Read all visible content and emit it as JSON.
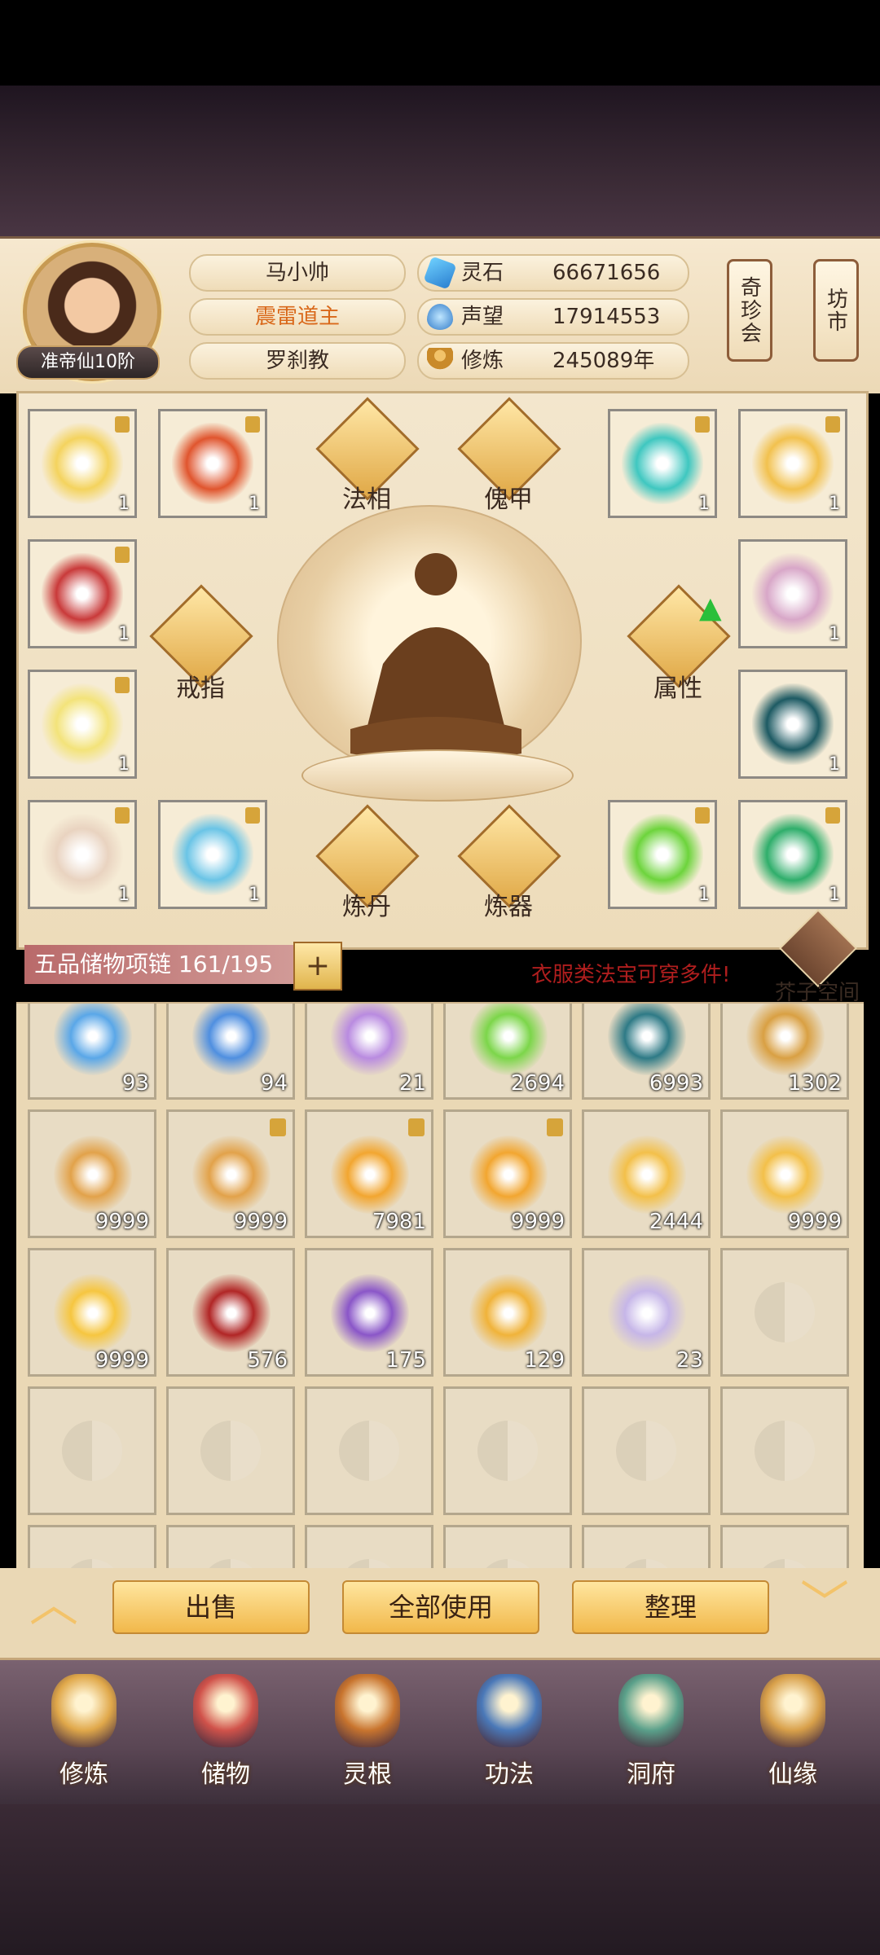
{
  "player": {
    "name": "马小帅",
    "title": "震雷道主",
    "sect": "罗刹教",
    "realm": "准帝仙10阶"
  },
  "resources": [
    {
      "label": "灵石",
      "value": "66671656",
      "icon": "spirit-stone-icon"
    },
    {
      "label": "声望",
      "value": "17914553",
      "icon": "prestige-icon"
    },
    {
      "label": "修炼",
      "value": "245089年",
      "icon": "cultivation-icon"
    }
  ],
  "side_buttons": {
    "treasure_shop": "奇珍会",
    "market": "坊市"
  },
  "equip_actions": {
    "faxiang": "法相",
    "kuijia": "傀甲",
    "ring": "戒指",
    "attributes": "属性",
    "alchemy": "炼丹",
    "forge": "炼器"
  },
  "equipment": [
    {
      "count": "1",
      "locked": true,
      "color": "#f4d35e"
    },
    {
      "count": "1",
      "locked": true,
      "color": "#e0552e"
    },
    {
      "count": "1",
      "locked": true,
      "color": "#3fc7c0"
    },
    {
      "count": "1",
      "locked": true,
      "color": "#f2c14e"
    },
    {
      "count": "1",
      "locked": true,
      "color": "#c93a3a"
    },
    {
      "count": "1",
      "locked": false,
      "color": "#d8a7c8"
    },
    {
      "count": "1",
      "locked": true,
      "color": "#f3e37a"
    },
    {
      "count": "1",
      "locked": false,
      "color": "#1d5a63"
    },
    {
      "count": "1",
      "locked": true,
      "color": "#e9d3c0"
    },
    {
      "count": "1",
      "locked": true,
      "color": "#6ac4e6"
    },
    {
      "count": "1",
      "locked": true,
      "color": "#6dd43c"
    },
    {
      "count": "1",
      "locked": true,
      "color": "#2fae6b"
    }
  ],
  "storage": {
    "title": "五品储物项链 161/195",
    "plus": "+",
    "hint": "衣服类法宝可穿多件!",
    "jiezi": "芥子空间"
  },
  "items": [
    {
      "count": "93",
      "locked": false,
      "color": "#5aa7e8"
    },
    {
      "count": "94",
      "locked": false,
      "color": "#4f8fe0"
    },
    {
      "count": "21",
      "locked": false,
      "color": "#b98be0"
    },
    {
      "count": "2694",
      "locked": false,
      "color": "#7cd64a"
    },
    {
      "count": "6993",
      "locked": false,
      "color": "#2e7a86"
    },
    {
      "count": "1302",
      "locked": false,
      "color": "#d9a043"
    },
    {
      "count": "9999",
      "locked": false,
      "color": "#e2a24a"
    },
    {
      "count": "9999",
      "locked": true,
      "color": "#e2a24a"
    },
    {
      "count": "7981",
      "locked": true,
      "color": "#f2a630"
    },
    {
      "count": "9999",
      "locked": true,
      "color": "#f2a630"
    },
    {
      "count": "2444",
      "locked": false,
      "color": "#f3c04a"
    },
    {
      "count": "9999",
      "locked": false,
      "color": "#f3c04a"
    },
    {
      "count": "9999",
      "locked": false,
      "color": "#f6c640"
    },
    {
      "count": "576",
      "locked": false,
      "color": "#b12626"
    },
    {
      "count": "175",
      "locked": false,
      "color": "#8a56c8"
    },
    {
      "count": "129",
      "locked": false,
      "color": "#f0b33a"
    },
    {
      "count": "23",
      "locked": false,
      "color": "#c6b6e8"
    }
  ],
  "actions": {
    "sell": "出售",
    "use_all": "全部使用",
    "sort": "整理"
  },
  "nav": [
    {
      "label": "修炼",
      "icon": "cultivate-icon",
      "color": "#e0a84a"
    },
    {
      "label": "储物",
      "icon": "bag-icon",
      "color": "#d0524a"
    },
    {
      "label": "灵根",
      "icon": "spirit-root-icon",
      "color": "#c8742e"
    },
    {
      "label": "功法",
      "icon": "book-icon",
      "color": "#4a78b8"
    },
    {
      "label": "洞府",
      "icon": "cave-icon",
      "color": "#5aa08a"
    },
    {
      "label": "仙缘",
      "icon": "gourd-icon",
      "color": "#d8a04a"
    }
  ]
}
